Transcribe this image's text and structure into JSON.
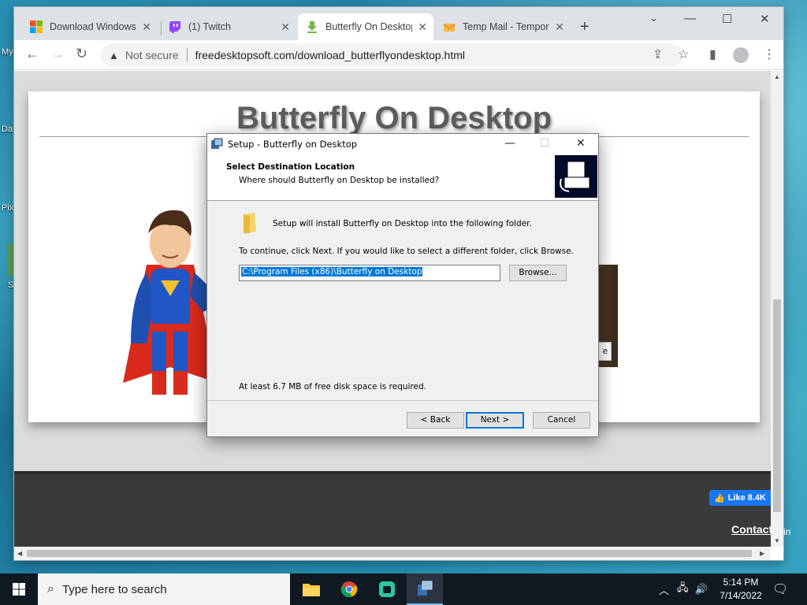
{
  "desktop": {
    "icons": [
      "My",
      "Da",
      "Pix",
      "St"
    ]
  },
  "browser": {
    "tabs": [
      {
        "title": "Download Windows",
        "icon": "windows-logo-icon"
      },
      {
        "title": "(1) Twitch",
        "icon": "twitch-icon"
      },
      {
        "title": "Butterfly On Desktop",
        "icon": "download-arrow-icon"
      },
      {
        "title": "Temp Mail - Tempora",
        "icon": "mail-icon"
      }
    ],
    "active_tab": 2,
    "address": {
      "security": "Not secure",
      "url": "freedesktopsoft.com/download_butterflyondesktop.html"
    }
  },
  "page": {
    "title": "Butterfly On Desktop",
    "like_label": "Like 8.4K",
    "contact_label": "Contact",
    "contact_suffix": "in",
    "dark_button_fragment": "e"
  },
  "dialog": {
    "title": "Setup - Butterfly on Desktop",
    "header_title": "Select Destination Location",
    "header_subtitle": "Where should Butterfly on Desktop be installed?",
    "install_text": "Setup will install Butterfly on Desktop into the following folder.",
    "continue_text": "To continue, click Next. If you would like to select a different folder, click Browse.",
    "path_value": "C:\\Program Files (x86)\\Butterfly on Desktop",
    "browse_label": "Browse...",
    "space_text": "At least 6.7 MB of free disk space is required.",
    "back_label": "< Back",
    "next_label": "Next >",
    "cancel_label": "Cancel"
  },
  "taskbar": {
    "search_placeholder": "Type here to search",
    "apps": [
      "file-explorer-icon",
      "chrome-icon",
      "app-icon",
      "setup-icon"
    ],
    "time": "5:14 PM",
    "date": "7/14/2022"
  }
}
